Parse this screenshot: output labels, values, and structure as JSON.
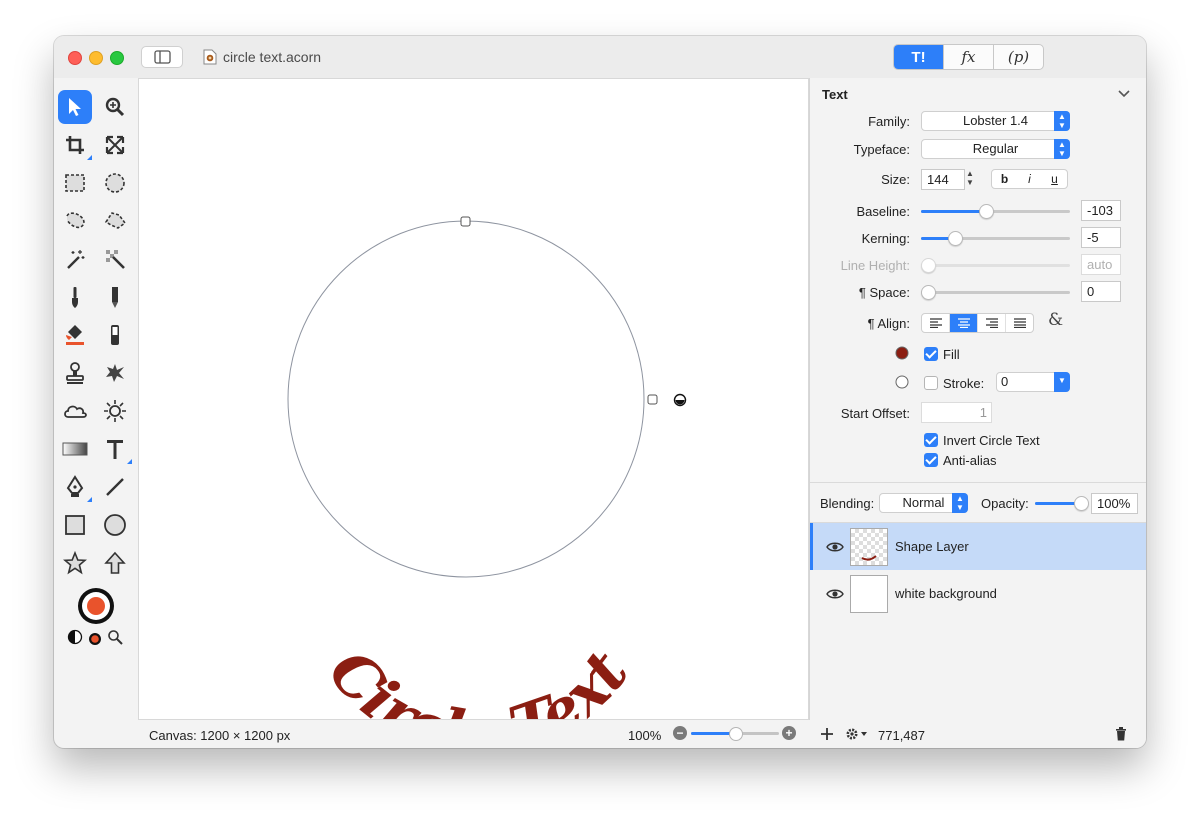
{
  "window": {
    "document_title": "circle text.acorn"
  },
  "toolbar": {
    "segments": [
      {
        "label": "T!",
        "icon": "tools-icon",
        "active": true
      },
      {
        "label": "fx",
        "icon": "effects-icon",
        "active": false
      },
      {
        "label": "(p)",
        "icon": "properties-icon",
        "active": false
      }
    ]
  },
  "tools": [
    {
      "name": "select-tool",
      "icon": "arrow-pointer-icon",
      "active": true
    },
    {
      "name": "zoom-tool",
      "icon": "magnifier-icon"
    },
    {
      "name": "crop-tool",
      "icon": "crop-icon"
    },
    {
      "name": "transform-tool",
      "icon": "expand-arrows-icon"
    },
    {
      "name": "rect-select-tool",
      "icon": "dashed-rectangle-icon"
    },
    {
      "name": "ellipse-select-tool",
      "icon": "dashed-circle-icon"
    },
    {
      "name": "lasso-tool",
      "icon": "lasso-icon"
    },
    {
      "name": "polygon-lasso-tool",
      "icon": "polygon-lasso-icon"
    },
    {
      "name": "magic-wand-tool",
      "icon": "magic-wand-icon"
    },
    {
      "name": "instant-alpha-tool",
      "icon": "checker-wand-icon"
    },
    {
      "name": "brush-tool",
      "icon": "brush-icon"
    },
    {
      "name": "pencil-tool",
      "icon": "pencil-icon"
    },
    {
      "name": "paint-bucket-tool",
      "icon": "paint-bucket-icon"
    },
    {
      "name": "eraser-tool",
      "icon": "eraser-icon"
    },
    {
      "name": "clone-tool",
      "icon": "stamp-icon"
    },
    {
      "name": "smudge-tool",
      "icon": "burst-icon"
    },
    {
      "name": "cloud-tool",
      "icon": "cloud-icon"
    },
    {
      "name": "dodge-tool",
      "icon": "sun-icon"
    },
    {
      "name": "gradient-tool",
      "icon": "gradient-icon"
    },
    {
      "name": "text-tool",
      "icon": "text-t-icon"
    },
    {
      "name": "pen-tool",
      "icon": "pen-nib-icon"
    },
    {
      "name": "line-tool",
      "icon": "line-icon"
    },
    {
      "name": "rectangle-shape-tool",
      "icon": "square-icon"
    },
    {
      "name": "oval-shape-tool",
      "icon": "circle-icon"
    },
    {
      "name": "star-tool",
      "icon": "star-icon"
    },
    {
      "name": "arrow-tool",
      "icon": "arrow-up-icon"
    }
  ],
  "colors": {
    "accent": "#2d7ff9",
    "text_color": "#8b1e12",
    "fg_swatch": "#e9532c"
  },
  "canvas": {
    "text": "Circle Text",
    "status": "Canvas: 1200 × 1200 px",
    "zoom": "100%",
    "zoom_fraction": 0.5
  },
  "inspector": {
    "section_title": "Text",
    "family_label": "Family:",
    "family_value": "Lobster 1.4",
    "typeface_label": "Typeface:",
    "typeface_value": "Regular",
    "size_label": "Size:",
    "size_value": "144",
    "bold": "b",
    "italic": "i",
    "underline": "u",
    "baseline_label": "Baseline:",
    "baseline_value": "-103",
    "baseline_level": 0.43,
    "kerning_label": "Kerning:",
    "kerning_value": "-5",
    "kerning_level": 0.22,
    "line_height_label": "Line Height:",
    "line_height_value": "auto",
    "space_label": "¶ Space:",
    "space_value": "0",
    "align_label": "¶ Align:",
    "fill_label": "Fill",
    "stroke_label": "Stroke:",
    "stroke_value": "0",
    "start_offset_label": "Start Offset:",
    "start_offset_value": "1",
    "invert_label": "Invert Circle Text",
    "antialias_label": "Anti-alias"
  },
  "blending": {
    "label": "Blending:",
    "value": "Normal",
    "opacity_label": "Opacity:",
    "opacity_value": "100%",
    "opacity_level": 1.0
  },
  "layers": [
    {
      "name": "Shape Layer",
      "selected": true
    },
    {
      "name": "white background",
      "selected": false
    }
  ],
  "bottom": {
    "coords": "771,487"
  }
}
